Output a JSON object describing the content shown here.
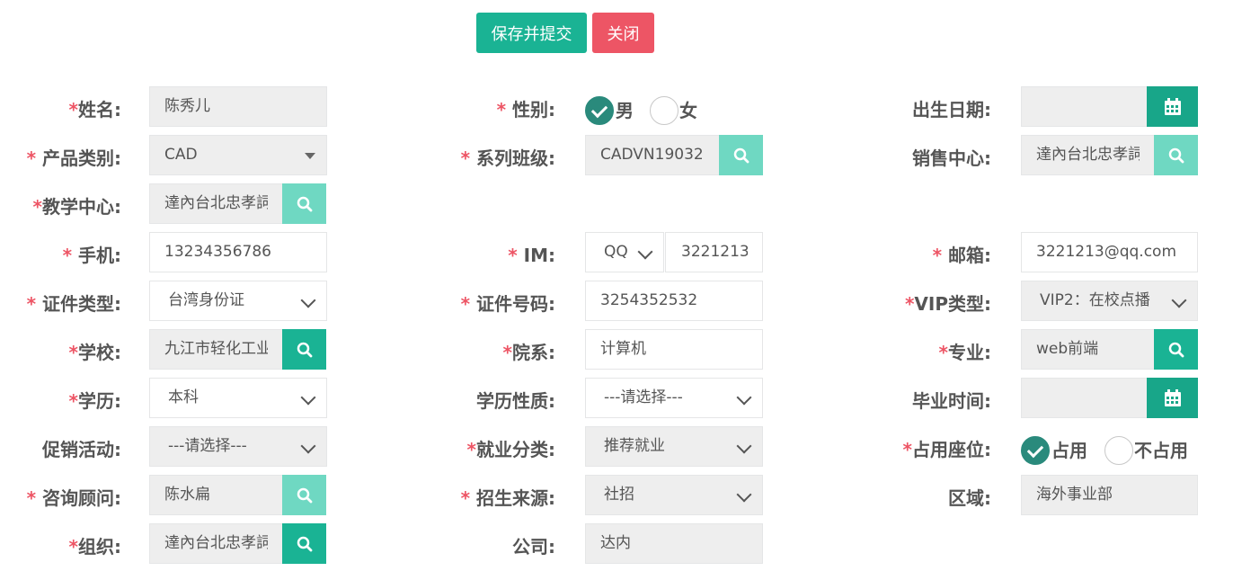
{
  "toolbar": {
    "save_label": "保存并提交",
    "close_label": "关闭"
  },
  "required_mark": "*",
  "fields": {
    "name": {
      "label": "姓名:",
      "value": "陈秀儿"
    },
    "gender": {
      "label": "性别:",
      "options": [
        "男",
        "女"
      ],
      "selected": "男"
    },
    "birthdate": {
      "label": "出生日期:",
      "value": ""
    },
    "product_category": {
      "label": "产品类别:",
      "value": "CAD"
    },
    "series_class": {
      "label": "系列班级:",
      "value": "CADVN19032"
    },
    "sales_center": {
      "label": "销售中心:",
      "value": "達內台北忠孝詞"
    },
    "teaching_center": {
      "label": "教学中心:",
      "value": "達內台北忠孝詞"
    },
    "phone": {
      "label": "手机:",
      "value": "13234356786"
    },
    "im": {
      "label": "IM:",
      "type_value": "QQ",
      "value": "3221213"
    },
    "email": {
      "label": "邮箱:",
      "value": "3221213@qq.com"
    },
    "id_type": {
      "label": "证件类型:",
      "value": "台湾身份证"
    },
    "id_number": {
      "label": "证件号码:",
      "value": "3254352532"
    },
    "vip_type": {
      "label": "VIP类型:",
      "value": "VIP2：在校点播"
    },
    "school": {
      "label": "学校:",
      "value": "九江市轻化工业学校"
    },
    "department": {
      "label": "院系:",
      "value": "计算机"
    },
    "major": {
      "label": "专业:",
      "value": "web前端"
    },
    "education": {
      "label": "学历:",
      "value": "本科"
    },
    "education_nature": {
      "label": "学历性质:",
      "value": "---请选择---"
    },
    "graduation_time": {
      "label": "毕业时间:",
      "value": ""
    },
    "promotion": {
      "label": "促销活动:",
      "value": "---请选择---"
    },
    "employment_category": {
      "label": "就业分类:",
      "value": "推荐就业"
    },
    "seat": {
      "label": "占用座位:",
      "options": [
        "占用",
        "不占用"
      ],
      "selected": "占用"
    },
    "consultant": {
      "label": "咨询顾问:",
      "value": "陈水扁"
    },
    "enroll_source": {
      "label": "招生来源:",
      "value": "社招"
    },
    "region": {
      "label": "区域:",
      "value": "海外事业部"
    },
    "organization": {
      "label": "组织:",
      "value": "達內台北忠孝詞"
    },
    "company": {
      "label": "公司:",
      "value": "达内"
    }
  },
  "colors": {
    "primary": "#1ab394",
    "primary_light": "#6fd8c2",
    "danger": "#ed5565",
    "radio_checked": "#2a8a7c"
  },
  "icons": {
    "search": "search-icon",
    "calendar": "calendar-icon",
    "dropdown": "chevron-down-icon"
  }
}
